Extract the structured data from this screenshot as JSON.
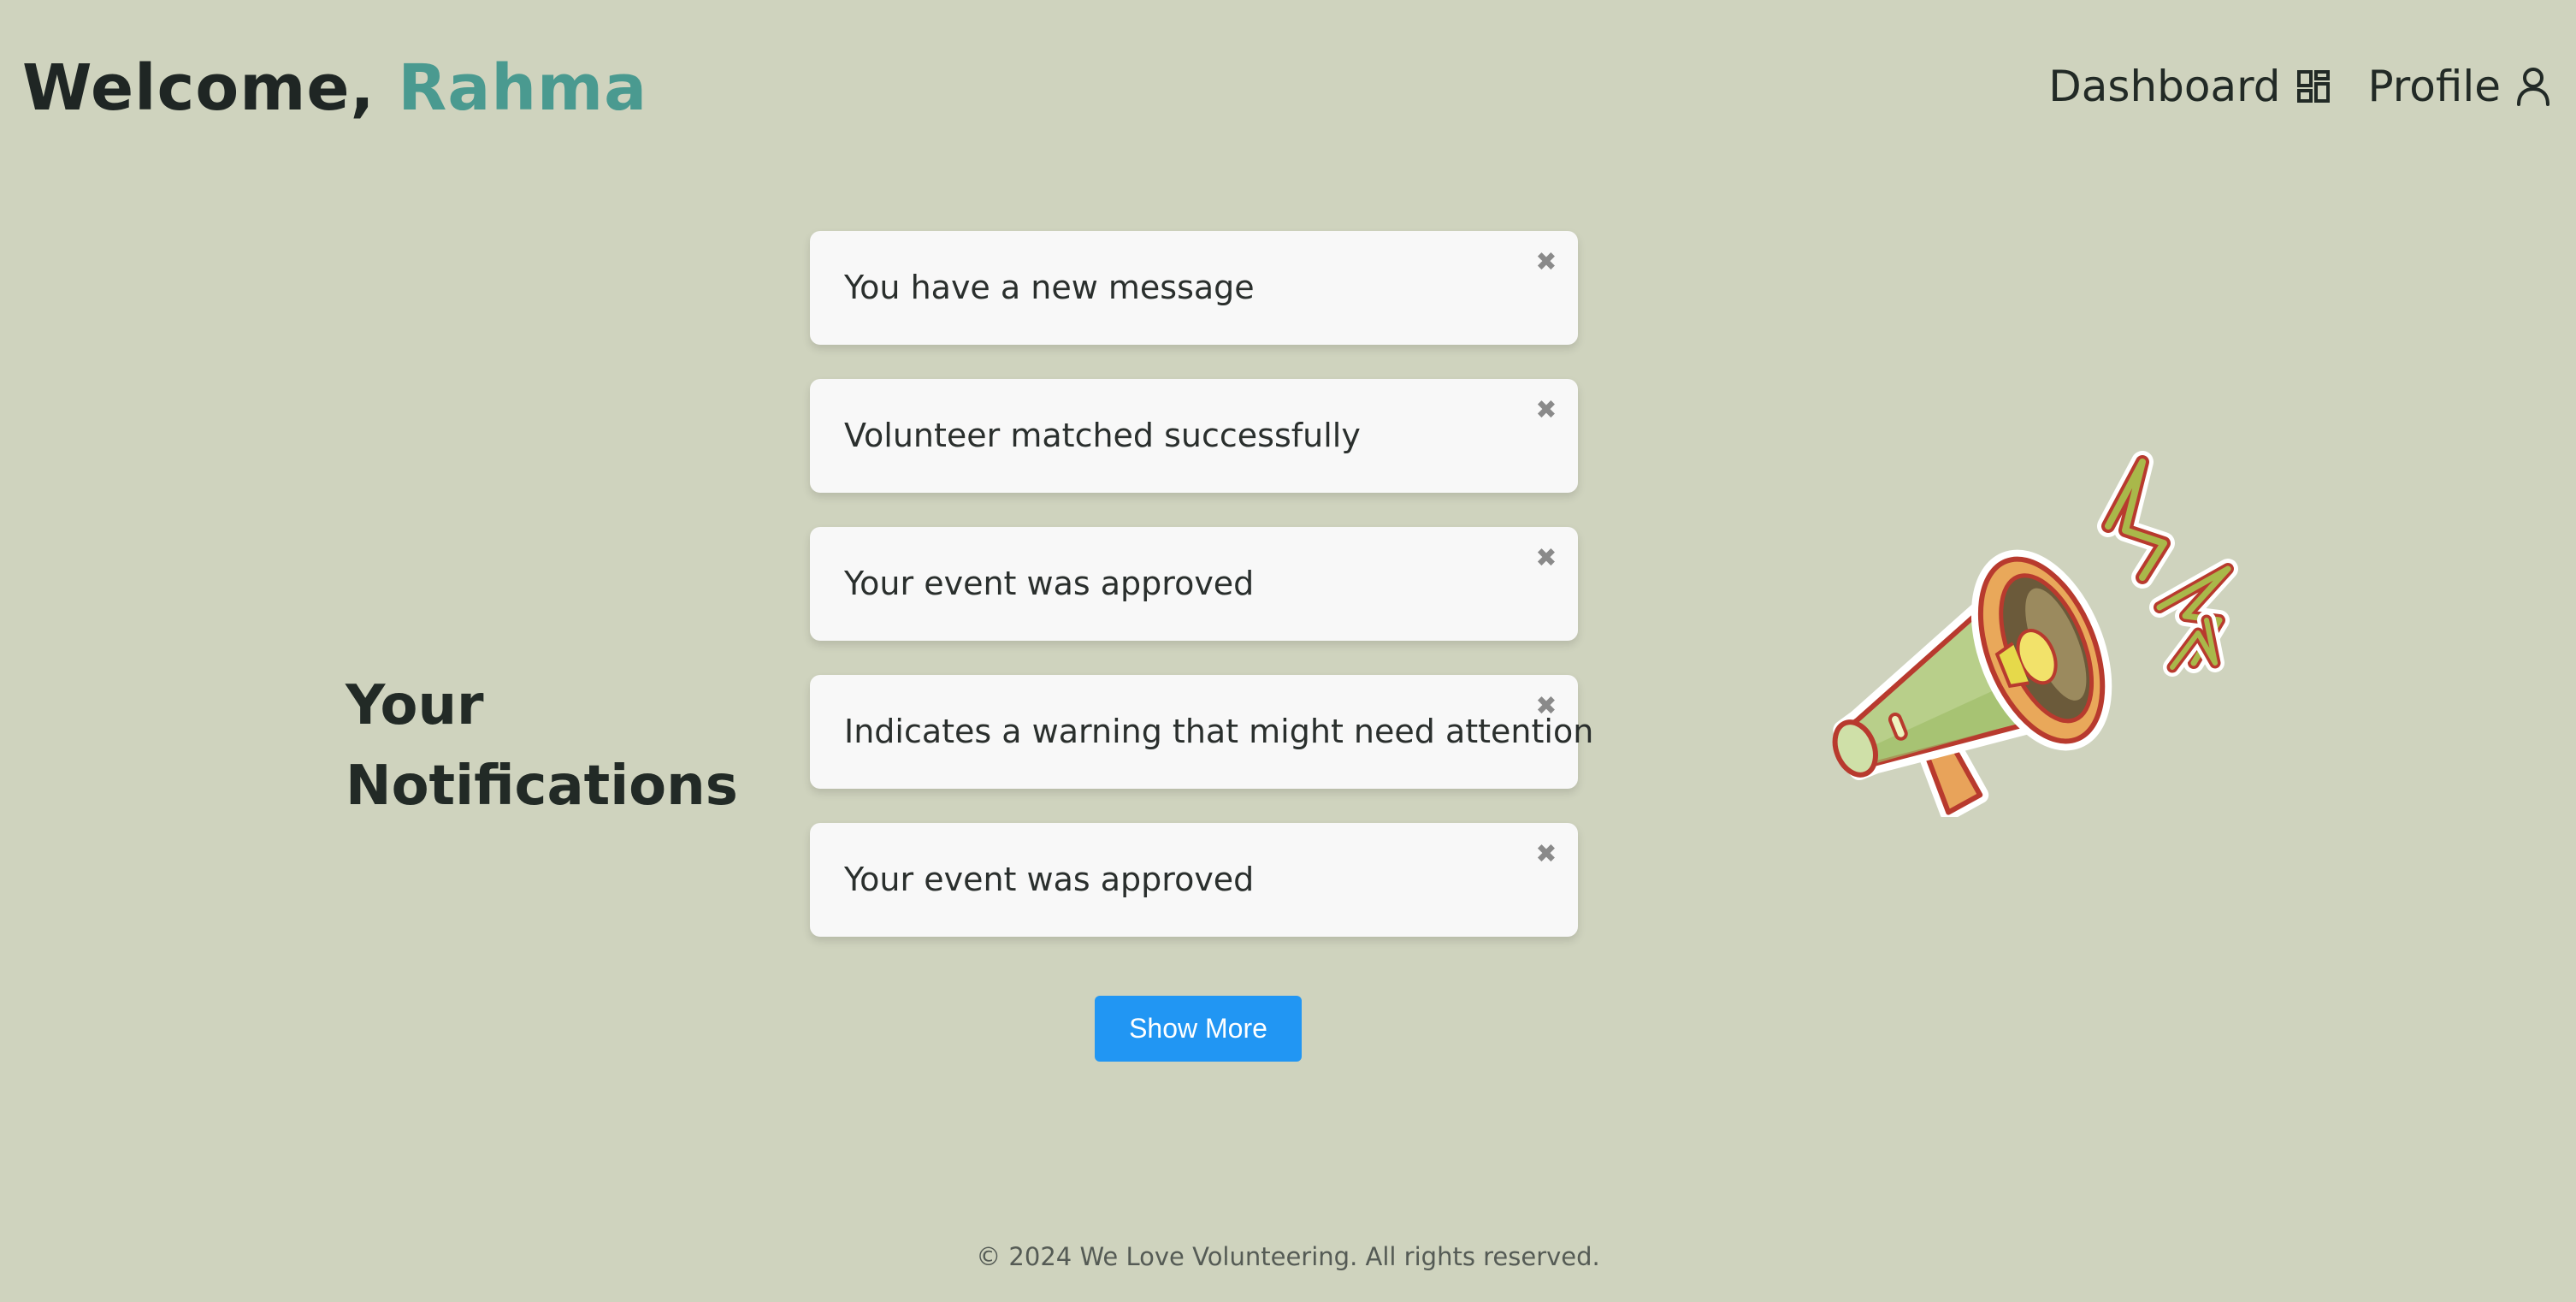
{
  "header": {
    "welcome_prefix": "Welcome,",
    "user_name": "Rahma",
    "nav": [
      {
        "label": "Dashboard",
        "icon": "dashboard-grid-icon"
      },
      {
        "label": "Profile",
        "icon": "user-icon"
      }
    ]
  },
  "main": {
    "heading_line1": "Your",
    "heading_line2": "Notifications",
    "notifications": [
      {
        "text": "You have a new message",
        "close": "✖"
      },
      {
        "text": "Volunteer matched successfully",
        "close": "✖"
      },
      {
        "text": "Your event was approved",
        "close": "✖"
      },
      {
        "text": "Indicates a warning that might need attention",
        "close": "✖"
      },
      {
        "text": "Your event was approved",
        "close": "✖"
      }
    ],
    "show_more_label": "Show More",
    "illustration_icon": "megaphone-icon"
  },
  "footer": {
    "text": "© 2024 We Love Volunteering. All rights reserved."
  },
  "colors": {
    "background": "#cfd3be",
    "accent_name": "#4a9a90",
    "button": "#2196f3",
    "card": "#f8f8f8"
  }
}
